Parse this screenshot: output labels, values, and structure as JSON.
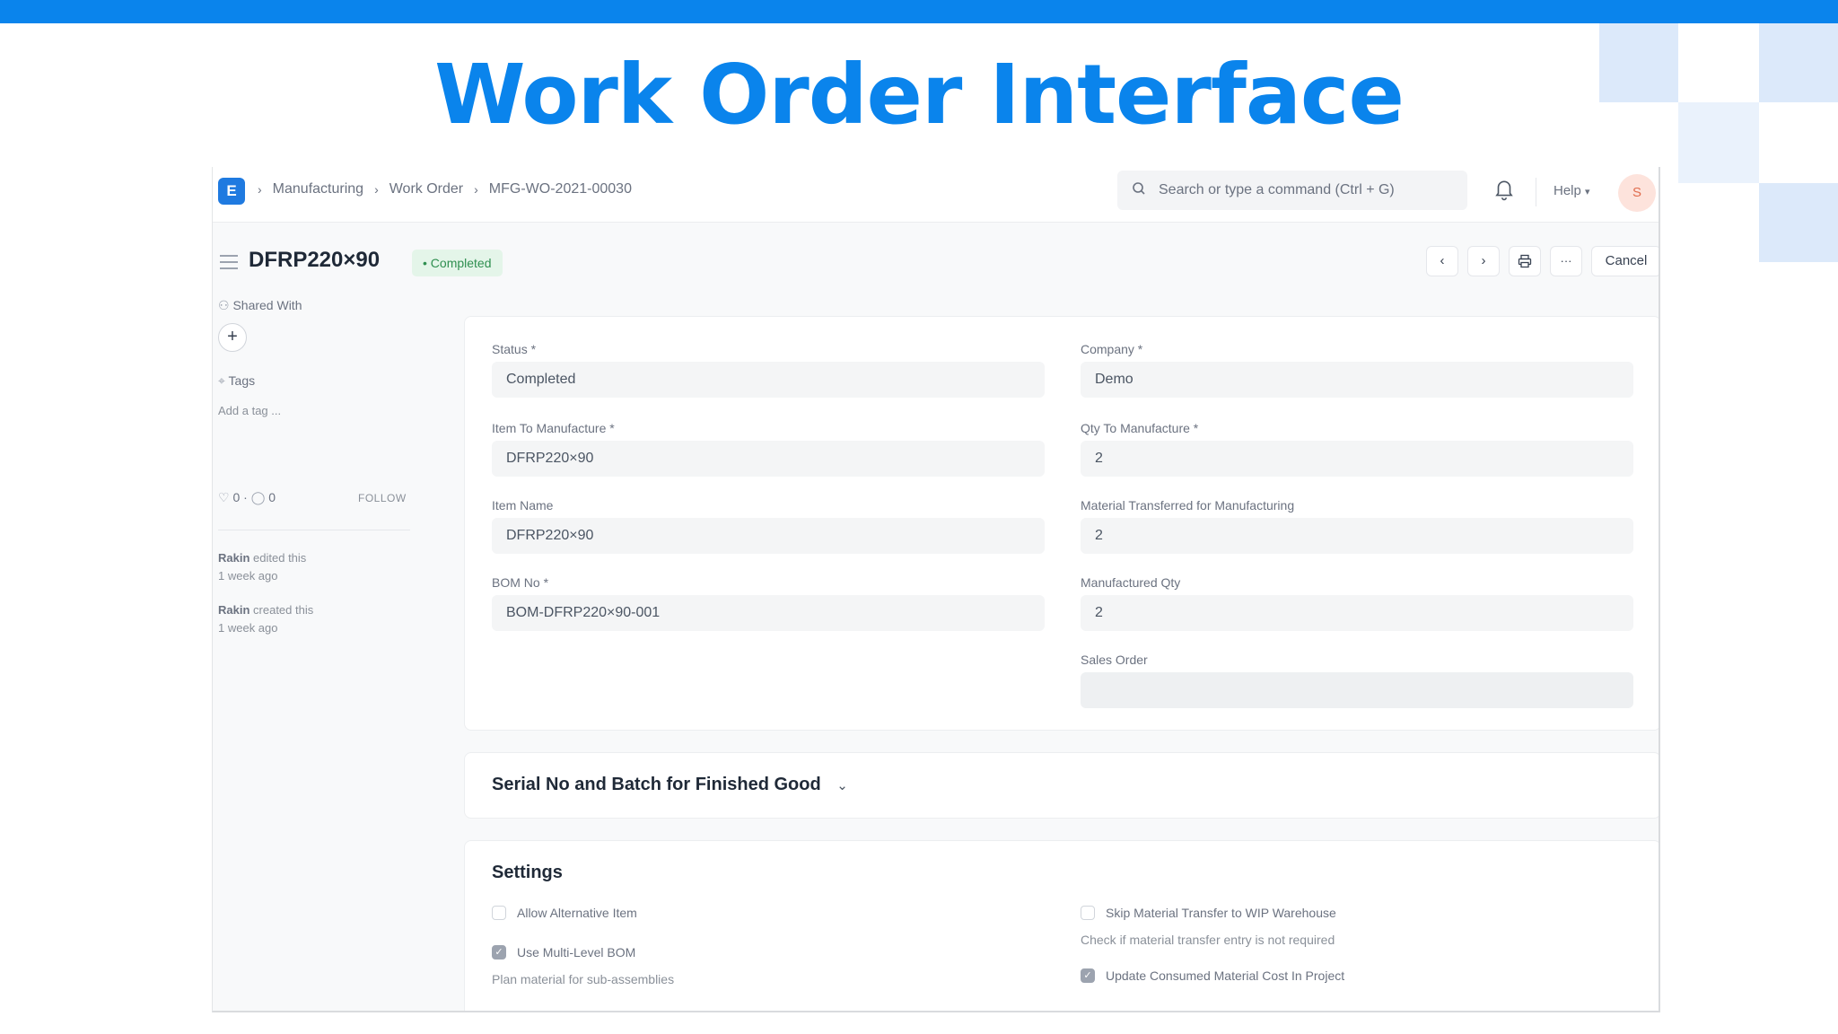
{
  "slide": {
    "title": "Work Order Interface"
  },
  "navbar": {
    "logo_letter": "E",
    "breadcrumbs": [
      "Manufacturing",
      "Work Order",
      "MFG-WO-2021-00030"
    ],
    "search_placeholder": "Search or type a command (Ctrl + G)",
    "help_label": "Help",
    "avatar_letter": "S"
  },
  "header": {
    "title": "DFRP220×90",
    "status_badge": "• Completed",
    "cancel_label": "Cancel",
    "more_label": "···"
  },
  "sidebar": {
    "shared_with_label": "Shared With",
    "tags_label": "Tags",
    "add_tag_label": "Add a tag ...",
    "likes_count": "0",
    "comments_count": "0",
    "follow_label": "FOLLOW",
    "activity": [
      {
        "user": "Rakin",
        "action": "edited this",
        "time": "1 week ago"
      },
      {
        "user": "Rakin",
        "action": "created this",
        "time": "1 week ago"
      }
    ]
  },
  "form": {
    "left": [
      {
        "label": "Status *",
        "value": "Completed"
      },
      {
        "label": "Item To Manufacture *",
        "value": "DFRP220×90"
      },
      {
        "label": "Item Name",
        "value": "DFRP220×90"
      },
      {
        "label": "BOM No *",
        "value": "BOM-DFRP220×90-001"
      }
    ],
    "right": [
      {
        "label": "Company *",
        "value": "Demo"
      },
      {
        "label": "Qty To Manufacture *",
        "value": "2"
      },
      {
        "label": "Material Transferred for Manufacturing",
        "value": "2"
      },
      {
        "label": "Manufactured Qty",
        "value": "2"
      },
      {
        "label": "Sales Order",
        "value": ""
      }
    ]
  },
  "serial_section": {
    "title": "Serial No and Batch for Finished Good"
  },
  "settings": {
    "title": "Settings",
    "allow_alternative": {
      "label": "Allow Alternative Item",
      "checked": false
    },
    "multi_level_bom": {
      "label": "Use Multi-Level BOM",
      "description": "Plan material for sub-assemblies",
      "checked": true
    },
    "skip_transfer": {
      "label": "Skip Material Transfer to WIP Warehouse",
      "description": "Check if material transfer entry is not required",
      "checked": false
    },
    "update_cost": {
      "label": "Update Consumed Material Cost In Project",
      "checked": true
    }
  }
}
